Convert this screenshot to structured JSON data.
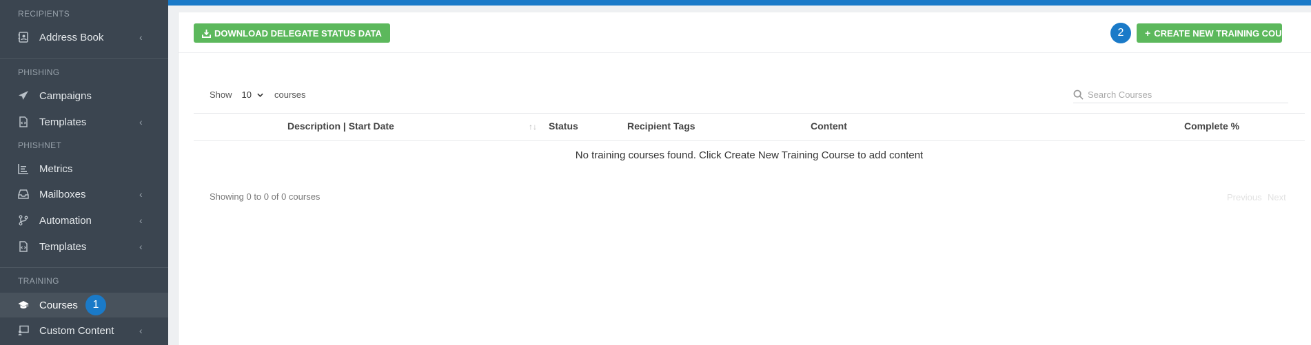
{
  "sidebar": {
    "sections": {
      "recipients": "RECIPIENTS",
      "phishing": "PHISHING",
      "phishnet": "PHISHNET",
      "training": "TRAINING"
    },
    "items": {
      "address_book": {
        "label": "Address Book",
        "icon": "address-book-icon",
        "expandable": true
      },
      "campaigns": {
        "label": "Campaigns",
        "icon": "paper-plane-icon",
        "expandable": false
      },
      "templates_phishing": {
        "label": "Templates",
        "icon": "file-code-icon",
        "expandable": true
      },
      "metrics": {
        "label": "Metrics",
        "icon": "chart-bars-icon",
        "expandable": false
      },
      "mailboxes": {
        "label": "Mailboxes",
        "icon": "inbox-icon",
        "expandable": true
      },
      "automation": {
        "label": "Automation",
        "icon": "branch-icon",
        "expandable": true
      },
      "templates_phishnet": {
        "label": "Templates",
        "icon": "file-code-icon",
        "expandable": true
      },
      "courses": {
        "label": "Courses",
        "icon": "graduation-cap-icon",
        "expandable": false,
        "active": true
      },
      "custom_content": {
        "label": "Custom Content",
        "icon": "presentation-icon",
        "expandable": true
      }
    },
    "chevron": "‹",
    "step_badge": "1"
  },
  "toolbar": {
    "download_label": "DOWNLOAD DELEGATE STATUS DATA",
    "create_label": "CREATE NEW TRAINING COURSE",
    "step_badge": "2"
  },
  "table": {
    "show_label": "Show",
    "page_size": "10",
    "page_size_suffix": "courses",
    "search_placeholder": "Search Courses",
    "columns": [
      "Description | Start Date",
      "Status",
      "Recipient Tags",
      "Content",
      "Complete %"
    ],
    "empty_message": "No training courses found. Click Create New Training Course to add content",
    "info": "Showing 0 to 0 of 0 courses",
    "pagination": {
      "previous": "Previous",
      "next": "Next"
    }
  },
  "colors": {
    "sidebar_bg": "#3b4550",
    "accent_blue": "#1a7ac8",
    "button_green": "#5cb85c"
  }
}
